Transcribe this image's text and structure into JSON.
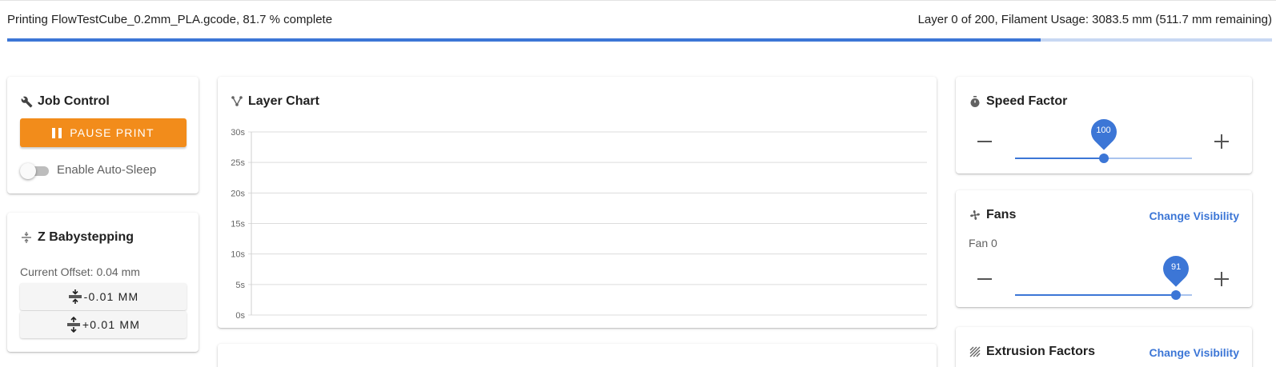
{
  "status": {
    "left_text": "Printing FlowTestCube_0.2mm_PLA.gcode, 81.7 % complete",
    "right_text": "Layer 0 of 200, Filament Usage: 3083.5 mm (511.7 mm remaining)",
    "progress_fraction": 0.817
  },
  "job_control": {
    "title": "Job Control",
    "icon": "wrench-icon",
    "pause_label": "PAUSE PRINT",
    "auto_sleep_label": "Enable Auto-Sleep",
    "auto_sleep_on": false
  },
  "babystep": {
    "title": "Z Babystepping",
    "icon": "babystep-icon",
    "current_offset": "Current Offset: 0.04 mm",
    "minus_label": "-0.01 MM",
    "plus_label": "+0.01 MM"
  },
  "layer_chart": {
    "title": "Layer Chart",
    "icon": "chart-branch-icon"
  },
  "chart_data": {
    "type": "line",
    "title": "",
    "xlabel": "",
    "ylabel": "",
    "ylim": [
      0,
      30
    ],
    "yticks": [
      "0s",
      "5s",
      "10s",
      "15s",
      "20s",
      "25s",
      "30s"
    ],
    "series": [],
    "grid": true
  },
  "speed_factor": {
    "title": "Speed Factor",
    "icon": "timer-icon",
    "value": 100,
    "value_text": "100",
    "min": 0,
    "max": 200
  },
  "fans": {
    "title": "Fans",
    "icon": "fan-icon",
    "change_visibility": "Change Visibility",
    "fan_name": "Fan 0",
    "value": 91,
    "value_text": "91",
    "min": 0,
    "max": 100
  },
  "extrusion": {
    "title": "Extrusion Factors",
    "icon": "hatch-icon",
    "change_visibility": "Change Visibility"
  },
  "colors": {
    "accent": "#3c76d6",
    "pause": "#f28c1b"
  }
}
